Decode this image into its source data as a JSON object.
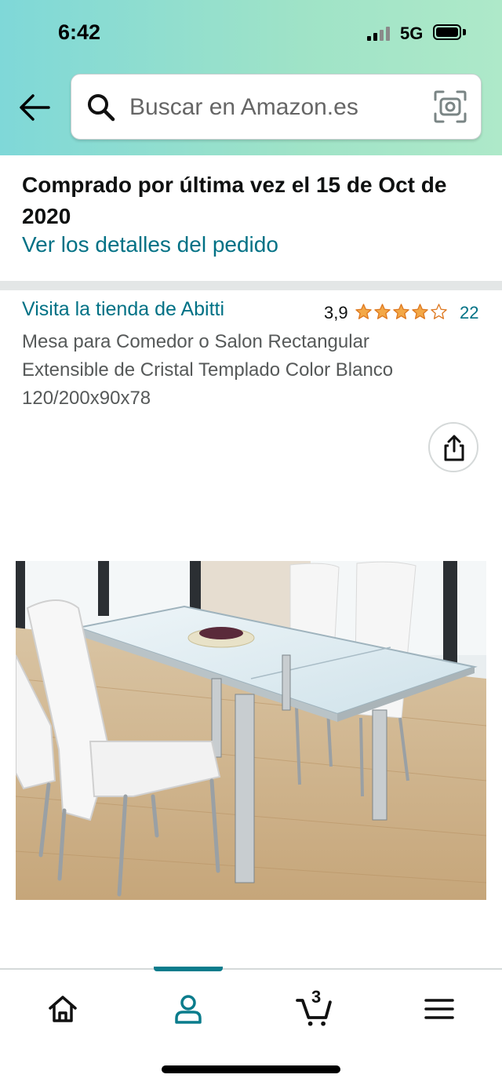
{
  "status_bar": {
    "time": "6:42",
    "network": "5G"
  },
  "search": {
    "placeholder": "Buscar en Amazon.es"
  },
  "order": {
    "last_purchased": "Comprado por última vez el 15 de Oct de 2020",
    "details_link": "Ver los detalles del pedido"
  },
  "product": {
    "store_link": "Visita la tienda de Abitti",
    "rating": "3,9",
    "rating_stars": 3.9,
    "rating_count": "22",
    "title": "Mesa para Comedor o Salon Rectangular Extensible de Cristal Templado Color Blanco 120/200x90x78"
  },
  "bottom_nav": {
    "items": [
      {
        "icon": "home-icon"
      },
      {
        "icon": "account-icon",
        "active": true
      },
      {
        "icon": "cart-icon",
        "count": "3"
      },
      {
        "icon": "menu-icon"
      }
    ]
  },
  "colors": {
    "accent": "#007185",
    "active_nav": "#0a7c8c",
    "star": "#f3a847",
    "header_start": "#7fd8d8",
    "header_end": "#aee9c9"
  }
}
